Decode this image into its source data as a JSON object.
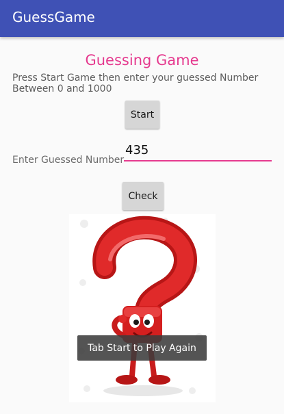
{
  "appbar": {
    "title": "GuessGame"
  },
  "game": {
    "title": "Guessing Game",
    "instructions": "Press  Start Game then enter your guessed Number Between 0 and 1000"
  },
  "start_button": {
    "label": "Start"
  },
  "guess": {
    "label": "Enter Guessed Number",
    "value": "435"
  },
  "check_button": {
    "label": "Check"
  },
  "image": {
    "icon": "question-mark-mascot-icon"
  },
  "toast": {
    "message": "Tab Start to Play Again"
  },
  "colors": {
    "appbar": "#3f51b5",
    "accent": "#e5398e",
    "button": "#d6d6d6",
    "mascot_red": "#d41f1f"
  }
}
